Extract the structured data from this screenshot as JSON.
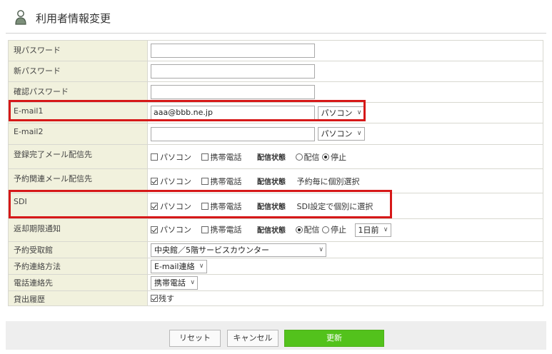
{
  "header": {
    "title": "利用者情報変更",
    "icon": "user-icon"
  },
  "rows": {
    "current_password": {
      "label": "現パスワード",
      "value": ""
    },
    "new_password": {
      "label": "新パスワード",
      "value": ""
    },
    "confirm_password": {
      "label": "確認パスワード",
      "value": ""
    },
    "email1": {
      "label": "E-mail1",
      "value": "aaa@bbb.ne.jp",
      "device": "パソコン"
    },
    "email2": {
      "label": "E-mail2",
      "value": "",
      "device": "パソコン"
    },
    "reg_mail": {
      "label": "登録完了メール配信先",
      "pc": "パソコン",
      "pc_checked": false,
      "mobile": "携帯電話",
      "mobile_checked": false,
      "status_label": "配信状態",
      "opt_deliver": "配信",
      "opt_stop": "停止",
      "selected": "停止"
    },
    "reserve_mail": {
      "label": "予約関連メール配信先",
      "pc": "パソコン",
      "pc_checked": true,
      "mobile": "携帯電話",
      "mobile_checked": false,
      "status_label": "配信状態",
      "status_note": "予約毎に個別選択"
    },
    "sdi": {
      "label": "SDI",
      "pc": "パソコン",
      "pc_checked": true,
      "mobile": "携帯電話",
      "mobile_checked": false,
      "status_label": "配信状態",
      "status_note": "SDI設定で個別に選択"
    },
    "return_notice": {
      "label": "返却期限通知",
      "pc": "パソコン",
      "pc_checked": true,
      "mobile": "携帯電話",
      "mobile_checked": false,
      "status_label": "配信状態",
      "opt_deliver": "配信",
      "opt_stop": "停止",
      "selected": "配信",
      "timing": "1日前"
    },
    "pickup": {
      "label": "予約受取館",
      "value": "中央館／5階サービスカウンター"
    },
    "contact_method": {
      "label": "予約連絡方法",
      "value": "E-mail連絡"
    },
    "phone_contact": {
      "label": "電話連絡先",
      "value": "携帯電話"
    },
    "history": {
      "label": "貸出履歴",
      "option": "残す",
      "checked": true
    }
  },
  "footer": {
    "reset": "リセット",
    "cancel": "キャンセル",
    "update": "更新"
  },
  "colors": {
    "label_bg": "#f1f1dd",
    "highlight": "#d61818",
    "update_button": "#53c21c",
    "footer_bg": "#eeeeee"
  }
}
